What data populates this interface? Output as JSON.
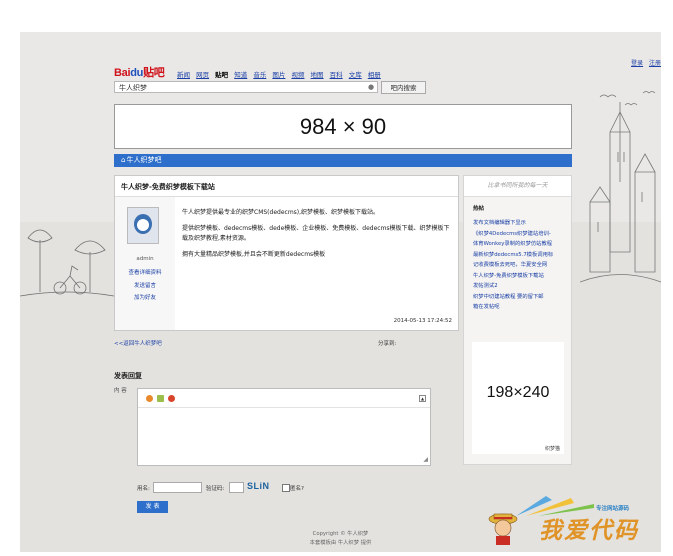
{
  "top_links": [
    "登录",
    "注册"
  ],
  "logo": {
    "left": "Bai",
    "paw": "du",
    "right": "贴吧"
  },
  "nav": [
    {
      "label": "新闻",
      "current": false
    },
    {
      "label": "网页",
      "current": false
    },
    {
      "label": "贴吧",
      "current": true
    },
    {
      "label": "知道",
      "current": false
    },
    {
      "label": "音乐",
      "current": false
    },
    {
      "label": "图片",
      "current": false
    },
    {
      "label": "视频",
      "current": false
    },
    {
      "label": "地图",
      "current": false
    },
    {
      "label": "百科",
      "current": false
    },
    {
      "label": "文库",
      "current": false
    },
    {
      "label": "相册",
      "current": false
    }
  ],
  "search": {
    "value": "牛人织梦",
    "button": "吧内搜索"
  },
  "banner": {
    "text": "984 × 90"
  },
  "forum_bar": {
    "title": "牛人织梦吧"
  },
  "post": {
    "title": "牛人织梦-免费织梦模板下载站",
    "author": "admin",
    "links": [
      "查看详细资料",
      "发送留言",
      "加为好友"
    ],
    "paragraphs": [
      "牛人织梦提供最专业的织梦CMS(dedecms),织梦模板、织梦模板下载站。",
      "提供织梦模板、dedecms模板、dede模板、企业模板、免费模板、dedecms模板下载、织梦模板下载及织梦教程,素材资源。",
      "拥有大量精品织梦模板,并且会不断更新dedecms模板"
    ],
    "time": "2014-05-13 17:24:52"
  },
  "back_link": "<<返回牛人织梦吧",
  "share_label": "分享到:",
  "sidebar": {
    "tagline": "比拿书同所我的每一天",
    "hot_title": "热帖",
    "hot_items": [
      "发布文档编辑器下显示",
      "《织梦4Dedecms织梦建站培训-",
      "体育Wonkey录制的织梦仿站教程",
      "最新织梦dedecms5.7模板调用标",
      "记收费模板去死吧，华夏安全网",
      "牛人织梦-免费织梦模板下载站",
      "发帖测试2",
      "织梦中切建站教程 要的留下邮",
      "箱在发帖呢"
    ],
    "ad_text": "198×240",
    "ad_caption": "织梦猫"
  },
  "reply": {
    "title": "发表回复",
    "content_label": "内 容",
    "name_label": "用名:",
    "captcha_label": "验证码:",
    "captcha_text": "SLiN",
    "anon_label": "匿名?",
    "submit_label": "发 表"
  },
  "footer": {
    "line1": "Copyright © 牛人织梦",
    "line2": "本套模板由 牛人织梦 提供"
  },
  "watermark": {
    "main": "我爱代码",
    "sub": "专注网站源码"
  },
  "colors": {
    "accent": "#2d6fcb",
    "logo_red": "#d0121b",
    "link": "#1a3fa6"
  }
}
